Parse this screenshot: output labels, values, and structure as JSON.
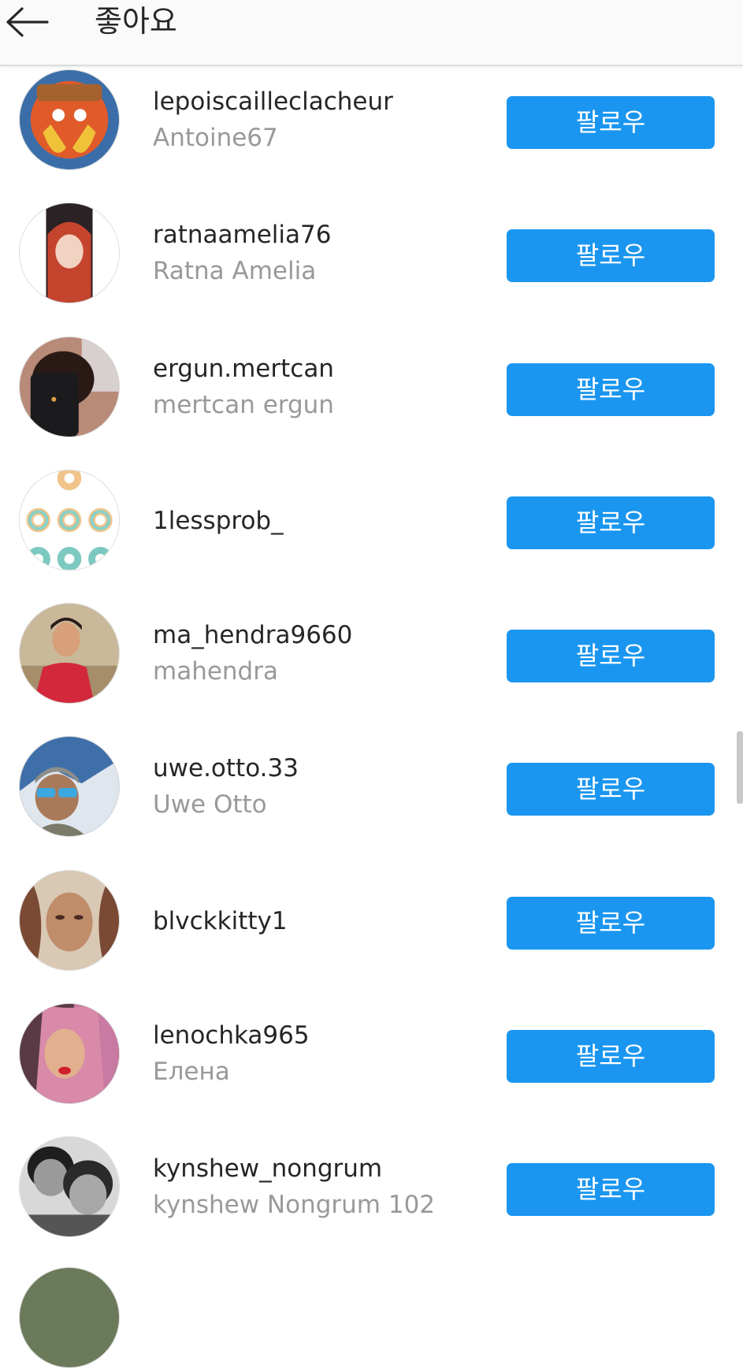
{
  "header": {
    "title": "좋아요",
    "back_icon": "arrow-left-icon"
  },
  "users": [
    {
      "username": "lepoiscailleclacheur",
      "fullname": "Antoine67",
      "button": "팔로우"
    },
    {
      "username": "ratnaamelia76",
      "fullname": "Ratna Amelia",
      "button": "팔로우"
    },
    {
      "username": "ergun.mertcan",
      "fullname": "mertcan ergun",
      "button": "팔로우"
    },
    {
      "username": "1lessprob_",
      "fullname": "",
      "button": "팔로우"
    },
    {
      "username": "ma_hendra9660",
      "fullname": "mahendra",
      "button": "팔로우"
    },
    {
      "username": "uwe.otto.33",
      "fullname": "Uwe Otto",
      "button": "팔로우"
    },
    {
      "username": "blvckkitty1",
      "fullname": "",
      "button": "팔로우"
    },
    {
      "username": "lenochka965",
      "fullname": "Елена",
      "button": "팔로우"
    },
    {
      "username": "kynshew_nongrum",
      "fullname": "kynshew Nongrum 102",
      "button": "팔로우"
    }
  ],
  "colors": {
    "follow_button": "#1a96f0",
    "username_text": "#262626",
    "fullname_text": "#999999"
  }
}
